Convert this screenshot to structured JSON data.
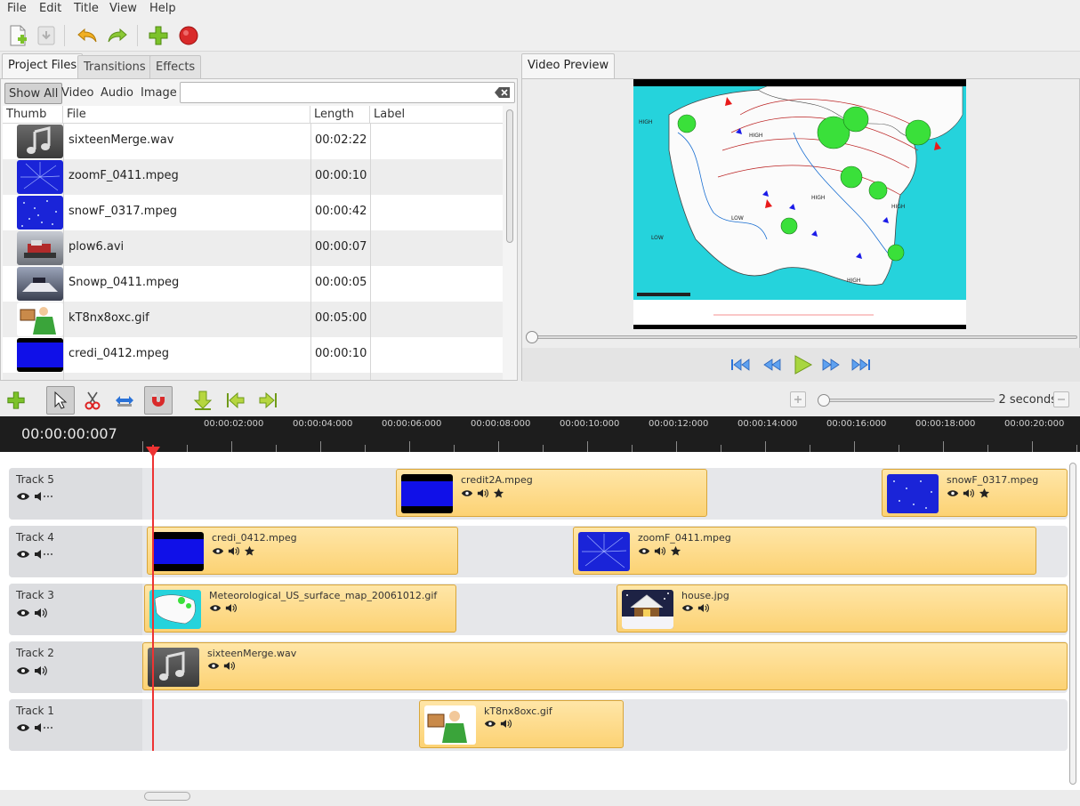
{
  "menu": [
    "File",
    "Edit",
    "Title",
    "View",
    "Help"
  ],
  "toolbar": {
    "icons": [
      "new-project-icon",
      "save-project-icon",
      "undo-icon",
      "redo-icon",
      "import-files-icon",
      "export-video-icon"
    ]
  },
  "project_files": {
    "tabs": [
      "Project Files",
      "Transitions",
      "Effects"
    ],
    "filters": [
      "Show All",
      "Video",
      "Audio",
      "Image"
    ],
    "search": {
      "value": "",
      "placeholder": ""
    },
    "columns": [
      "Thumb",
      "File",
      "Length",
      "Label"
    ],
    "rows": [
      {
        "thumb": "audio",
        "file": "sixteenMerge.wav",
        "length": "00:02:22",
        "label": ""
      },
      {
        "thumb": "zoom",
        "file": "zoomF_0411.mpeg",
        "length": "00:00:10",
        "label": ""
      },
      {
        "thumb": "snow",
        "file": "snowF_0317.mpeg",
        "length": "00:00:42",
        "label": ""
      },
      {
        "thumb": "plow",
        "file": "plow6.avi",
        "length": "00:00:07",
        "label": ""
      },
      {
        "thumb": "snowp",
        "file": "Snowp_0411.mpeg",
        "length": "00:00:05",
        "label": ""
      },
      {
        "thumb": "cartoon",
        "file": "kT8nx8oxc.gif",
        "length": "00:05:00",
        "label": ""
      },
      {
        "thumb": "blue",
        "file": "credi_0412.mpeg",
        "length": "00:00:10",
        "label": ""
      }
    ]
  },
  "video_preview": {
    "tab": "Video Preview",
    "seek_fraction": 0.0,
    "map_labels": [
      "HIGH",
      "HIGH",
      "HIGH",
      "LOW",
      "LOW",
      "HIGH",
      "HIGH"
    ]
  },
  "timeline": {
    "zoom_label": "2 seconds",
    "timecode": "00:00:00:007",
    "ruler_labels": [
      "00:00:02:000",
      "00:00:04:000",
      "00:00:06:000",
      "00:00:08:000",
      "00:00:10:000",
      "00:00:12:000",
      "00:00:14:000",
      "00:00:16:000",
      "00:00:18:000",
      "00:00:20:000"
    ],
    "tracks": [
      {
        "name": "Track 5",
        "audio_muted": true
      },
      {
        "name": "Track 4",
        "audio_muted": true
      },
      {
        "name": "Track 3",
        "audio_muted": false
      },
      {
        "name": "Track 2",
        "audio_muted": false
      },
      {
        "name": "Track 1",
        "audio_muted": true
      }
    ],
    "clips": {
      "t5a": "credit2A.mpeg",
      "t5b": "snowF_0317.mpeg",
      "t4a": "credi_0412.mpeg",
      "t4b": "zoomF_0411.mpeg",
      "t3a": "Meteorological_US_surface_map_20061012.gif",
      "t3b": "house.jpg",
      "t2a": "sixteenMerge.wav",
      "t1a": "kT8nx8oxc.gif"
    }
  },
  "colors": {
    "clip": "#fcd274",
    "playhead": "#ee3333",
    "ruler": "#1d1d1d",
    "accent_green": "#7cc22a"
  }
}
